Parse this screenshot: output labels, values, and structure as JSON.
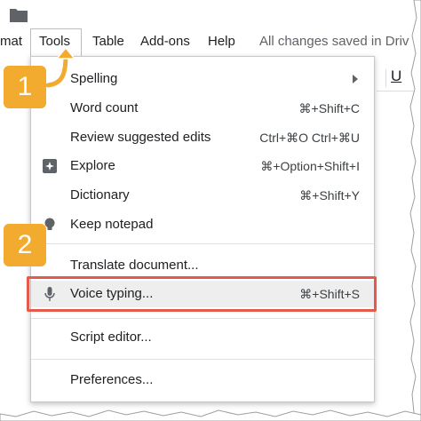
{
  "menubar": {
    "items": [
      "mat",
      "Tools",
      "Table",
      "Add-ons",
      "Help"
    ],
    "status": "All changes saved in Driv"
  },
  "toolbar": {
    "underline_label": "U"
  },
  "menu": {
    "items": [
      {
        "label": "Spelling",
        "shortcut": "",
        "icon": "",
        "submenu": true
      },
      {
        "label": "Word count",
        "shortcut": "⌘+Shift+C",
        "icon": ""
      },
      {
        "label": "Review suggested edits",
        "shortcut": "Ctrl+⌘O Ctrl+⌘U",
        "icon": ""
      },
      {
        "label": "Explore",
        "shortcut": "⌘+Option+Shift+I",
        "icon": "explore-icon"
      },
      {
        "label": "Dictionary",
        "shortcut": "⌘+Shift+Y",
        "icon": ""
      },
      {
        "label": "Keep notepad",
        "shortcut": "",
        "icon": "lightbulb-icon"
      },
      {
        "label": "Translate document...",
        "shortcut": "",
        "icon": ""
      },
      {
        "label": "Voice typing...",
        "shortcut": "⌘+Shift+S",
        "icon": "microphone-icon",
        "highlighted": true
      },
      {
        "label": "Script editor...",
        "shortcut": "",
        "icon": ""
      },
      {
        "label": "Preferences...",
        "shortcut": "",
        "icon": ""
      }
    ]
  },
  "callouts": {
    "first": "1",
    "second": "2"
  },
  "colors": {
    "callout": "#f2ab2f",
    "highlight_border": "#e55a4b",
    "hover": "#eeeeee"
  }
}
